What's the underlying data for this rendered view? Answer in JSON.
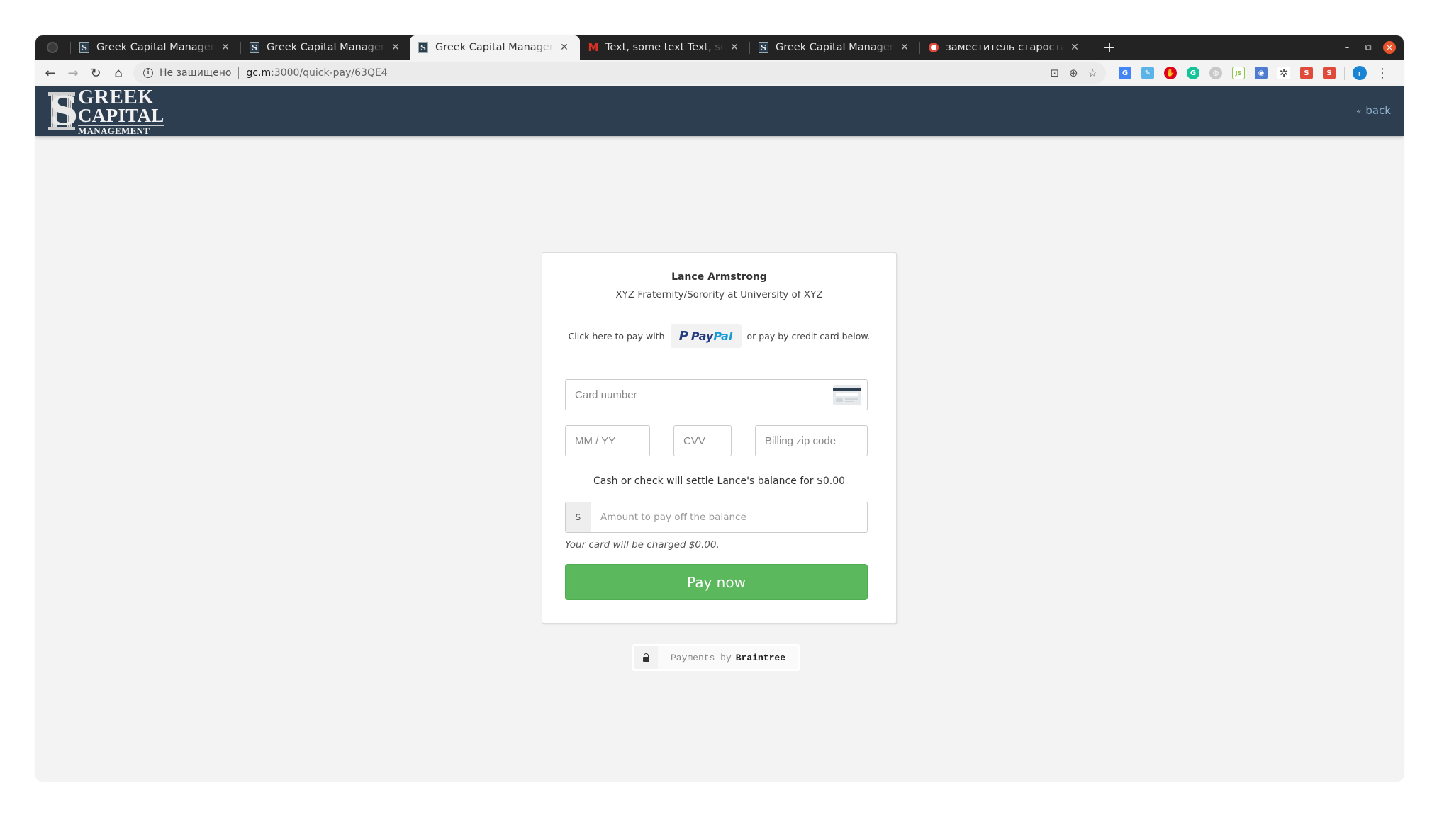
{
  "browser": {
    "tabs": [
      {
        "label": "",
        "favicon": "github-icon",
        "pinned": true
      },
      {
        "label": "Greek Capital Management",
        "favicon": "gcm-icon"
      },
      {
        "label": "Greek Capital Management",
        "favicon": "gcm-icon"
      },
      {
        "label": "Greek Capital Management",
        "favicon": "gcm-icon",
        "active": true
      },
      {
        "label": "Text, some text Text, some text",
        "favicon": "gmail-icon"
      },
      {
        "label": "Greek Capital Management",
        "favicon": "gcm-icon"
      },
      {
        "label": "заместитель староста - Translate",
        "favicon": "translate-icon"
      }
    ],
    "new_tab_label": "+",
    "window_controls": {
      "minimize": "–",
      "restore": "⧉",
      "close": "✕"
    },
    "omnibox": {
      "security_label": "Не защищено",
      "url_host": "gc.m",
      "url_path": ":3000/quick-pay/63QE4"
    },
    "extensions": [
      {
        "name": "google-translate-icon",
        "color": "#4285f4",
        "glyph": "G"
      },
      {
        "name": "tweeten-icon",
        "color": "#5ab4e8",
        "glyph": "✎"
      },
      {
        "name": "adblock-icon",
        "color": "#e0001b",
        "glyph": "✋"
      },
      {
        "name": "grammarly-icon",
        "color": "#15c39a",
        "glyph": "G"
      },
      {
        "name": "globe-icon",
        "color": "#bbbbbb",
        "glyph": "◍"
      },
      {
        "name": "nodejs-icon",
        "color": "#8cc84b",
        "glyph": "JS"
      },
      {
        "name": "screenshot-icon",
        "color": "#4f7cd1",
        "glyph": "◉"
      },
      {
        "name": "openai-icon",
        "color": "#444444",
        "glyph": "✲"
      },
      {
        "name": "squirrel-icon",
        "color": "#e04a3a",
        "glyph": "🐿"
      },
      {
        "name": "squirrel-icon",
        "color": "#e04a3a",
        "glyph": "🐿"
      }
    ],
    "profile_initial": "r",
    "colors": {
      "profile": "#1a84d4",
      "tabstrip": "#232323",
      "close_button": "#e9542b"
    }
  },
  "site": {
    "logo": {
      "line1": "GREEK",
      "line2": "CAPITAL",
      "line3": "MANAGEMENT"
    },
    "back_label": "back",
    "header_color": "#2c3e4f"
  },
  "payment": {
    "payer_name": "Lance Armstrong",
    "organization": "XYZ Fraternity/Sorority at University of XYZ",
    "paypal_prefix": "Click here to pay with",
    "paypal_pay": "Pay",
    "paypal_pal": "Pal",
    "paypal_suffix": "or pay by credit card below.",
    "card_number_placeholder": "Card number",
    "expiry_placeholder": "MM / YY",
    "cvv_placeholder": "CVV",
    "zip_placeholder": "Billing zip code",
    "settle_text": "Cash or check will settle Lance's balance for $0.00",
    "currency_symbol": "$",
    "amount_placeholder": "Amount to pay off the balance",
    "charged_text": "Your card will be charged $0.00.",
    "pay_button": "Pay now",
    "pay_button_color": "#5cb85c",
    "braintree_prefix": "Payments by",
    "braintree_brand": "Braintree"
  }
}
